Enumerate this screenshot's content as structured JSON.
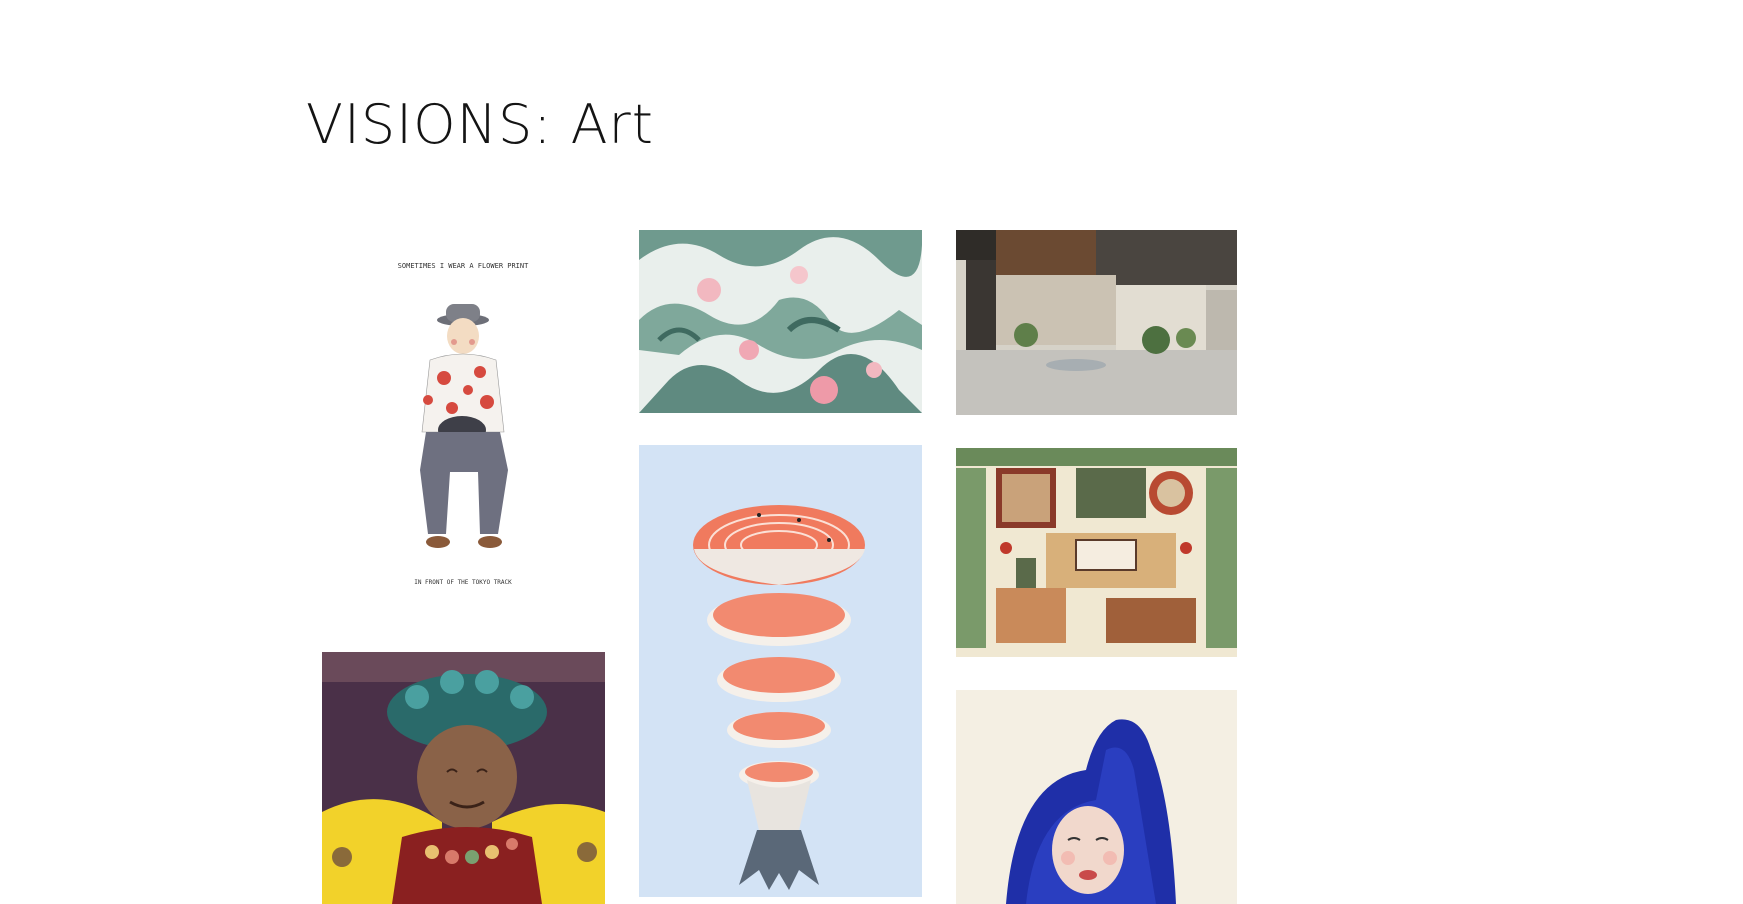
{
  "page": {
    "title": "VISIONS: Art"
  },
  "artworks": [
    {
      "subject": "man-flower-shirt-illustration",
      "caption_top": "SOMETIMES I WEAR A FLOWER PRINT",
      "caption_bottom": "IN FRONT OF THE TOKYO TRACK"
    },
    {
      "subject": "green-watercolor-abstract"
    },
    {
      "subject": "japanese-street-photo"
    },
    {
      "subject": "salmon-slices-running-track"
    },
    {
      "subject": "chinese-library-interior-drawing"
    },
    {
      "subject": "portrait-with-headdress"
    },
    {
      "subject": "blue-hair-woman-painting"
    }
  ],
  "colors": {
    "background": "#ffffff",
    "title": "#141414",
    "salmon": "#f07a5e",
    "sky": "#cfe0f4",
    "sage": "#7fa89b"
  }
}
